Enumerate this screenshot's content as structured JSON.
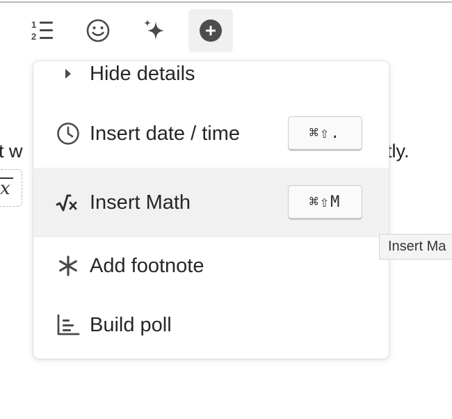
{
  "toolbar": {
    "buttons": [
      {
        "name": "numbered-list",
        "icon": "numbered-list-icon"
      },
      {
        "name": "emoji",
        "icon": "smiley-icon"
      },
      {
        "name": "ai-sparkle",
        "icon": "sparkle-icon"
      },
      {
        "name": "insert",
        "icon": "plus-circle-icon",
        "active": true
      }
    ]
  },
  "document": {
    "fragment_left": "t w",
    "fragment_right": "tly.",
    "math_chip_symbol": "x"
  },
  "menu": {
    "items": [
      {
        "label": "Hide details",
        "icon": "triangle-right-icon"
      },
      {
        "label": "Insert date / time",
        "icon": "clock-icon",
        "shortcut": "⌘⇧."
      },
      {
        "label": "Insert Math",
        "icon": "square-root-icon",
        "shortcut": "⌘⇧M",
        "highlighted": true
      },
      {
        "label": "Add footnote",
        "icon": "asterisk-icon"
      },
      {
        "label": "Build poll",
        "icon": "bar-chart-icon"
      }
    ]
  },
  "tooltip": {
    "text": "Insert Ma"
  },
  "colors": {
    "highlight": "#f1f1f1",
    "icon": "#4a4a4a",
    "text": "#262626"
  }
}
